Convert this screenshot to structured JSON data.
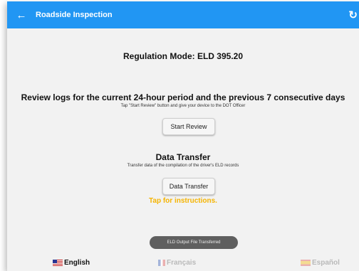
{
  "header": {
    "back_icon": "arrow-left-icon",
    "title": "Roadside Inspection",
    "refresh_icon": "refresh-icon",
    "color": "#2196f3"
  },
  "regulation": {
    "text": "Regulation Mode: ELD 395.20"
  },
  "review": {
    "heading": "Review logs for the current 24-hour period and the previous 7 consecutive days",
    "subtext": "Tap \"Start Review\" button and give your device to the DOT Officer",
    "button_label": "Start Review"
  },
  "transfer": {
    "heading": "Data Transfer",
    "subtext": "Transfer data of the compilation of the driver's ELD records",
    "button_label": "Data Transfer",
    "instructions": "Tap for instructions.",
    "instructions_color": "#f5b400"
  },
  "toast": {
    "text": "ELD Output File Transferred"
  },
  "languages": [
    {
      "label": "English",
      "flag": "us-flag-icon"
    },
    {
      "label": "Français",
      "flag": "fr-flag-icon"
    },
    {
      "label": "Español",
      "flag": "es-flag-icon"
    }
  ]
}
